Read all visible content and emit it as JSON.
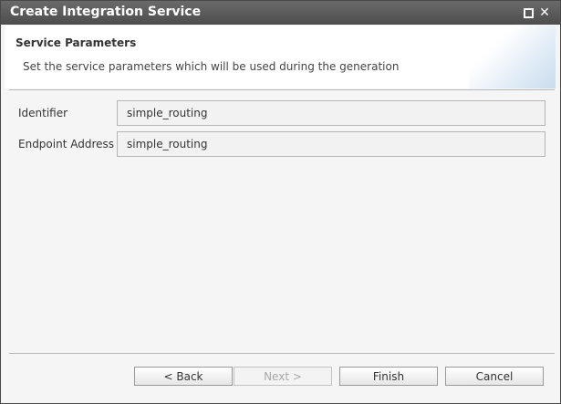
{
  "window": {
    "title": "Create Integration Service",
    "maximize_icon": "square-icon",
    "close_icon": "x-icon"
  },
  "header": {
    "title": "Service Parameters",
    "description": "Set the service parameters which will be used during the generation"
  },
  "form": {
    "fields": [
      {
        "label": "Identifier",
        "value": "simple_routing"
      },
      {
        "label": "Endpoint Address",
        "value": "simple_routing"
      }
    ]
  },
  "buttons": {
    "back": "< Back",
    "next": "Next >",
    "finish": "Finish",
    "cancel": "Cancel"
  },
  "colors": {
    "titlebar": "#555555",
    "dialog_background": "#f5f5f5",
    "header_background": "#ffffff"
  }
}
